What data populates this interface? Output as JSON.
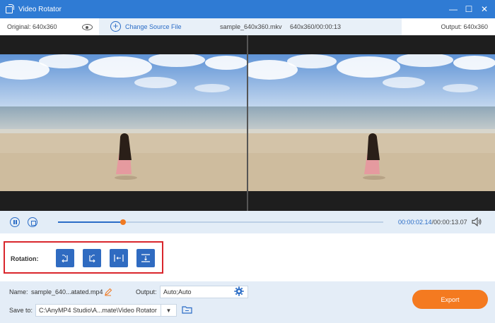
{
  "window": {
    "title": "Video Rotator",
    "controls": {
      "minimize": "—",
      "maximize": "☐",
      "close": "✕"
    }
  },
  "infobar": {
    "original_label": "Original: 640x360",
    "change_source_label": "Change Source File",
    "filename": "sample_640x360.mkv",
    "resolution_duration": "640x360/00:00:13",
    "output_label": "Output: 640x360"
  },
  "playback": {
    "current_time": "00:00:02.14",
    "duration": "/00:00:13.07",
    "progress": 0.2
  },
  "rotation": {
    "label": "Rotation:",
    "buttons": [
      {
        "name": "rotate-left",
        "icon": "rotate-left-icon"
      },
      {
        "name": "rotate-right",
        "icon": "rotate-right-icon"
      },
      {
        "name": "flip-horizontal",
        "icon": "flip-horizontal-icon"
      },
      {
        "name": "flip-vertical",
        "icon": "flip-vertical-icon"
      }
    ]
  },
  "bottom": {
    "name_label": "Name:",
    "name_value": "sample_640...atated.mp4",
    "output_label": "Output:",
    "output_value": "Auto;Auto",
    "save_label": "Save to:",
    "save_path": "C:\\AnyMP4 Studio\\A...mate\\Video Rotator",
    "export_label": "Export"
  },
  "colors": {
    "titlebar": "#2f7bd4",
    "accent": "#2a6cc6",
    "export": "#f47a20",
    "highlight_border": "#d9262c"
  }
}
